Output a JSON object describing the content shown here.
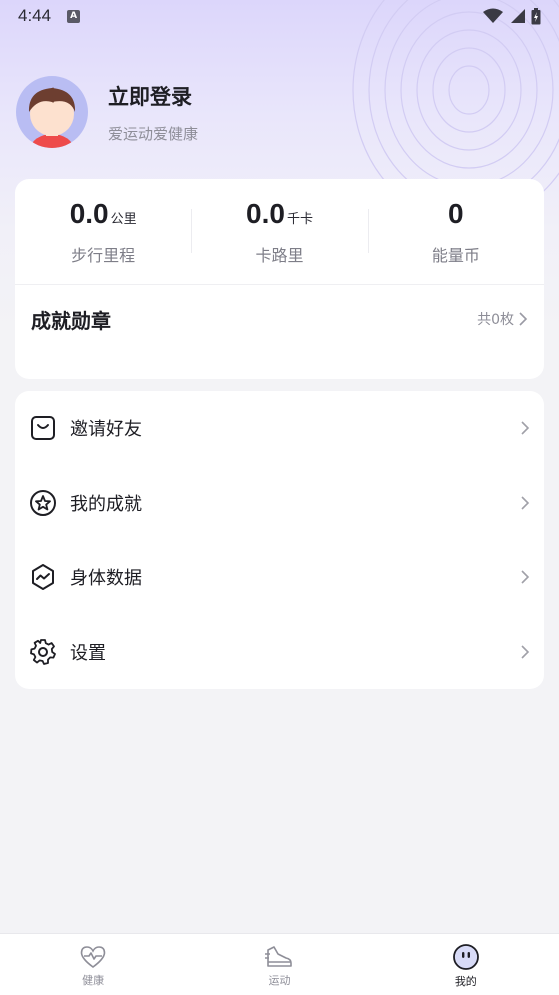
{
  "status": {
    "time": "4:44",
    "indicator": "A"
  },
  "profile": {
    "title": "立即登录",
    "subtitle": "爱运动爱健康"
  },
  "stats": [
    {
      "value": "0.0",
      "unit": "公里",
      "label": "步行里程"
    },
    {
      "value": "0.0",
      "unit": "千卡",
      "label": "卡路里"
    },
    {
      "value": "0",
      "unit": "",
      "label": "能量币"
    }
  ],
  "medals": {
    "title": "成就勋章",
    "count": "共0枚"
  },
  "menu": [
    {
      "label": "邀请好友",
      "icon": "invite-icon"
    },
    {
      "label": "我的成就",
      "icon": "star-badge-icon"
    },
    {
      "label": "身体数据",
      "icon": "body-data-icon"
    },
    {
      "label": "设置",
      "icon": "gear-icon"
    }
  ],
  "tabs": [
    {
      "label": "健康",
      "icon": "heart-pulse-icon",
      "active": false
    },
    {
      "label": "运动",
      "icon": "sneaker-icon",
      "active": false
    },
    {
      "label": "我的",
      "icon": "face-icon",
      "active": true
    }
  ],
  "colors": {
    "accent": "#b9bdf3",
    "header_gradient": "#dcd6fb",
    "background": "#f3f3f6"
  }
}
